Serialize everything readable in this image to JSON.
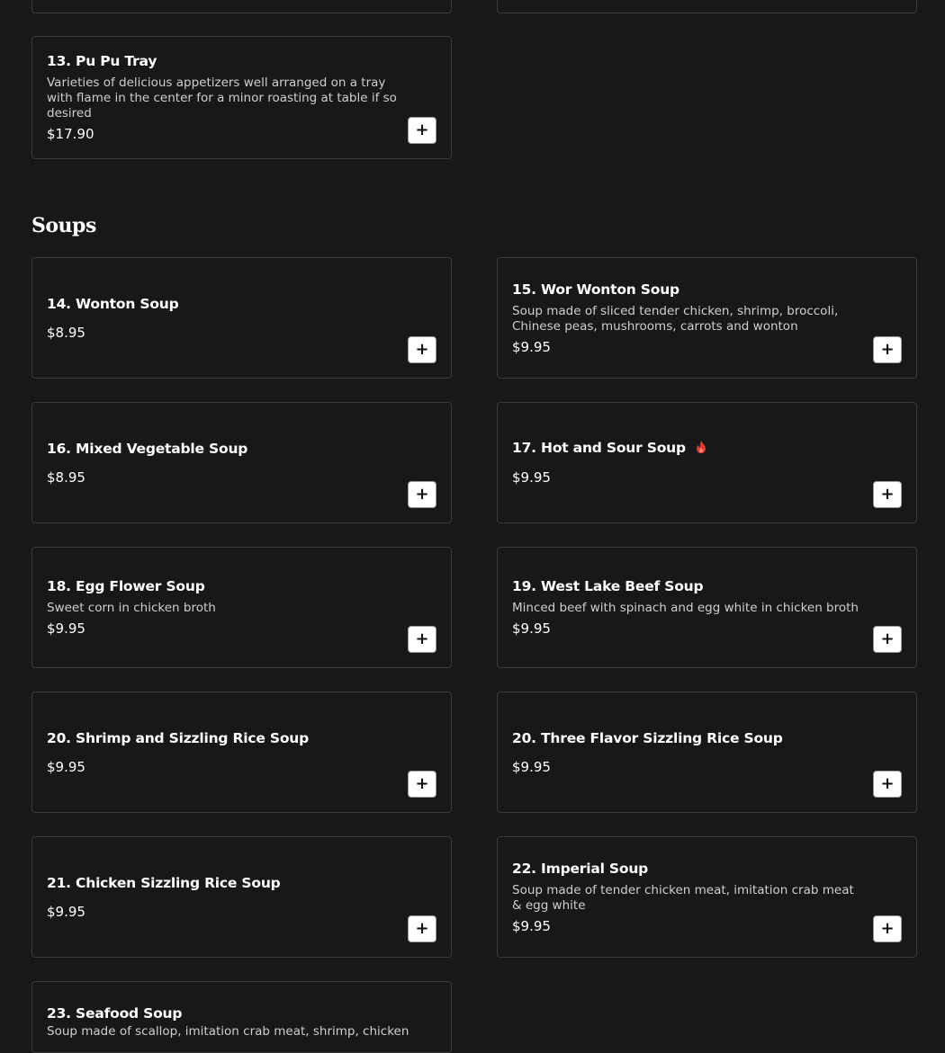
{
  "sections": {
    "soups_title": "Soups"
  },
  "items": {
    "pu_pu_tray": {
      "name": "13. Pu Pu Tray",
      "description": "Varieties of delicious appetizers well arranged on a tray with flame in the center for a minor roasting at table if so desired",
      "price": "$17.90"
    },
    "wonton_soup": {
      "name": "14. Wonton Soup",
      "price": "$8.95"
    },
    "wor_wonton_soup": {
      "name": "15. Wor Wonton Soup",
      "description": "Soup made of sliced tender chicken, shrimp, broccoli, Chinese peas, mushrooms, carrots and wonton",
      "price": "$9.95"
    },
    "mixed_vegetable_soup": {
      "name": "16. Mixed Vegetable Soup",
      "price": "$8.95"
    },
    "hot_and_sour_soup": {
      "name": "17. Hot and Sour Soup",
      "price": "$9.95",
      "spicy_icon": "flame-icon",
      "spicy_color": "#e5392f"
    },
    "egg_flower_soup": {
      "name": "18. Egg Flower Soup",
      "description": "Sweet corn in chicken broth",
      "price": "$9.95"
    },
    "west_lake_beef_soup": {
      "name": "19. West Lake Beef Soup",
      "description": "Minced beef with spinach and egg white in chicken broth",
      "price": "$9.95"
    },
    "shrimp_sizzling_rice_soup": {
      "name": "20. Shrimp and Sizzling Rice Soup",
      "price": "$9.95"
    },
    "three_flavor_sizzling_rice_soup": {
      "name": "20. Three Flavor Sizzling Rice Soup",
      "price": "$9.95"
    },
    "chicken_sizzling_rice_soup": {
      "name": "21. Chicken Sizzling Rice Soup",
      "price": "$9.95"
    },
    "imperial_soup": {
      "name": "22. Imperial Soup",
      "description": "Soup made of tender chicken meat, imitation crab meat & egg white",
      "price": "$9.95"
    },
    "seafood_soup": {
      "name": "23. Seafood Soup",
      "description": "Soup made of scallop, imitation crab meat, shrimp, chicken"
    }
  },
  "add_button_icon": "plus-icon",
  "colors": {
    "background": "#181818",
    "card_border": "#3a3a3a",
    "text": "#ffffff",
    "description_text": "#cfcfcf",
    "add_button_bg": "#ffffff"
  }
}
